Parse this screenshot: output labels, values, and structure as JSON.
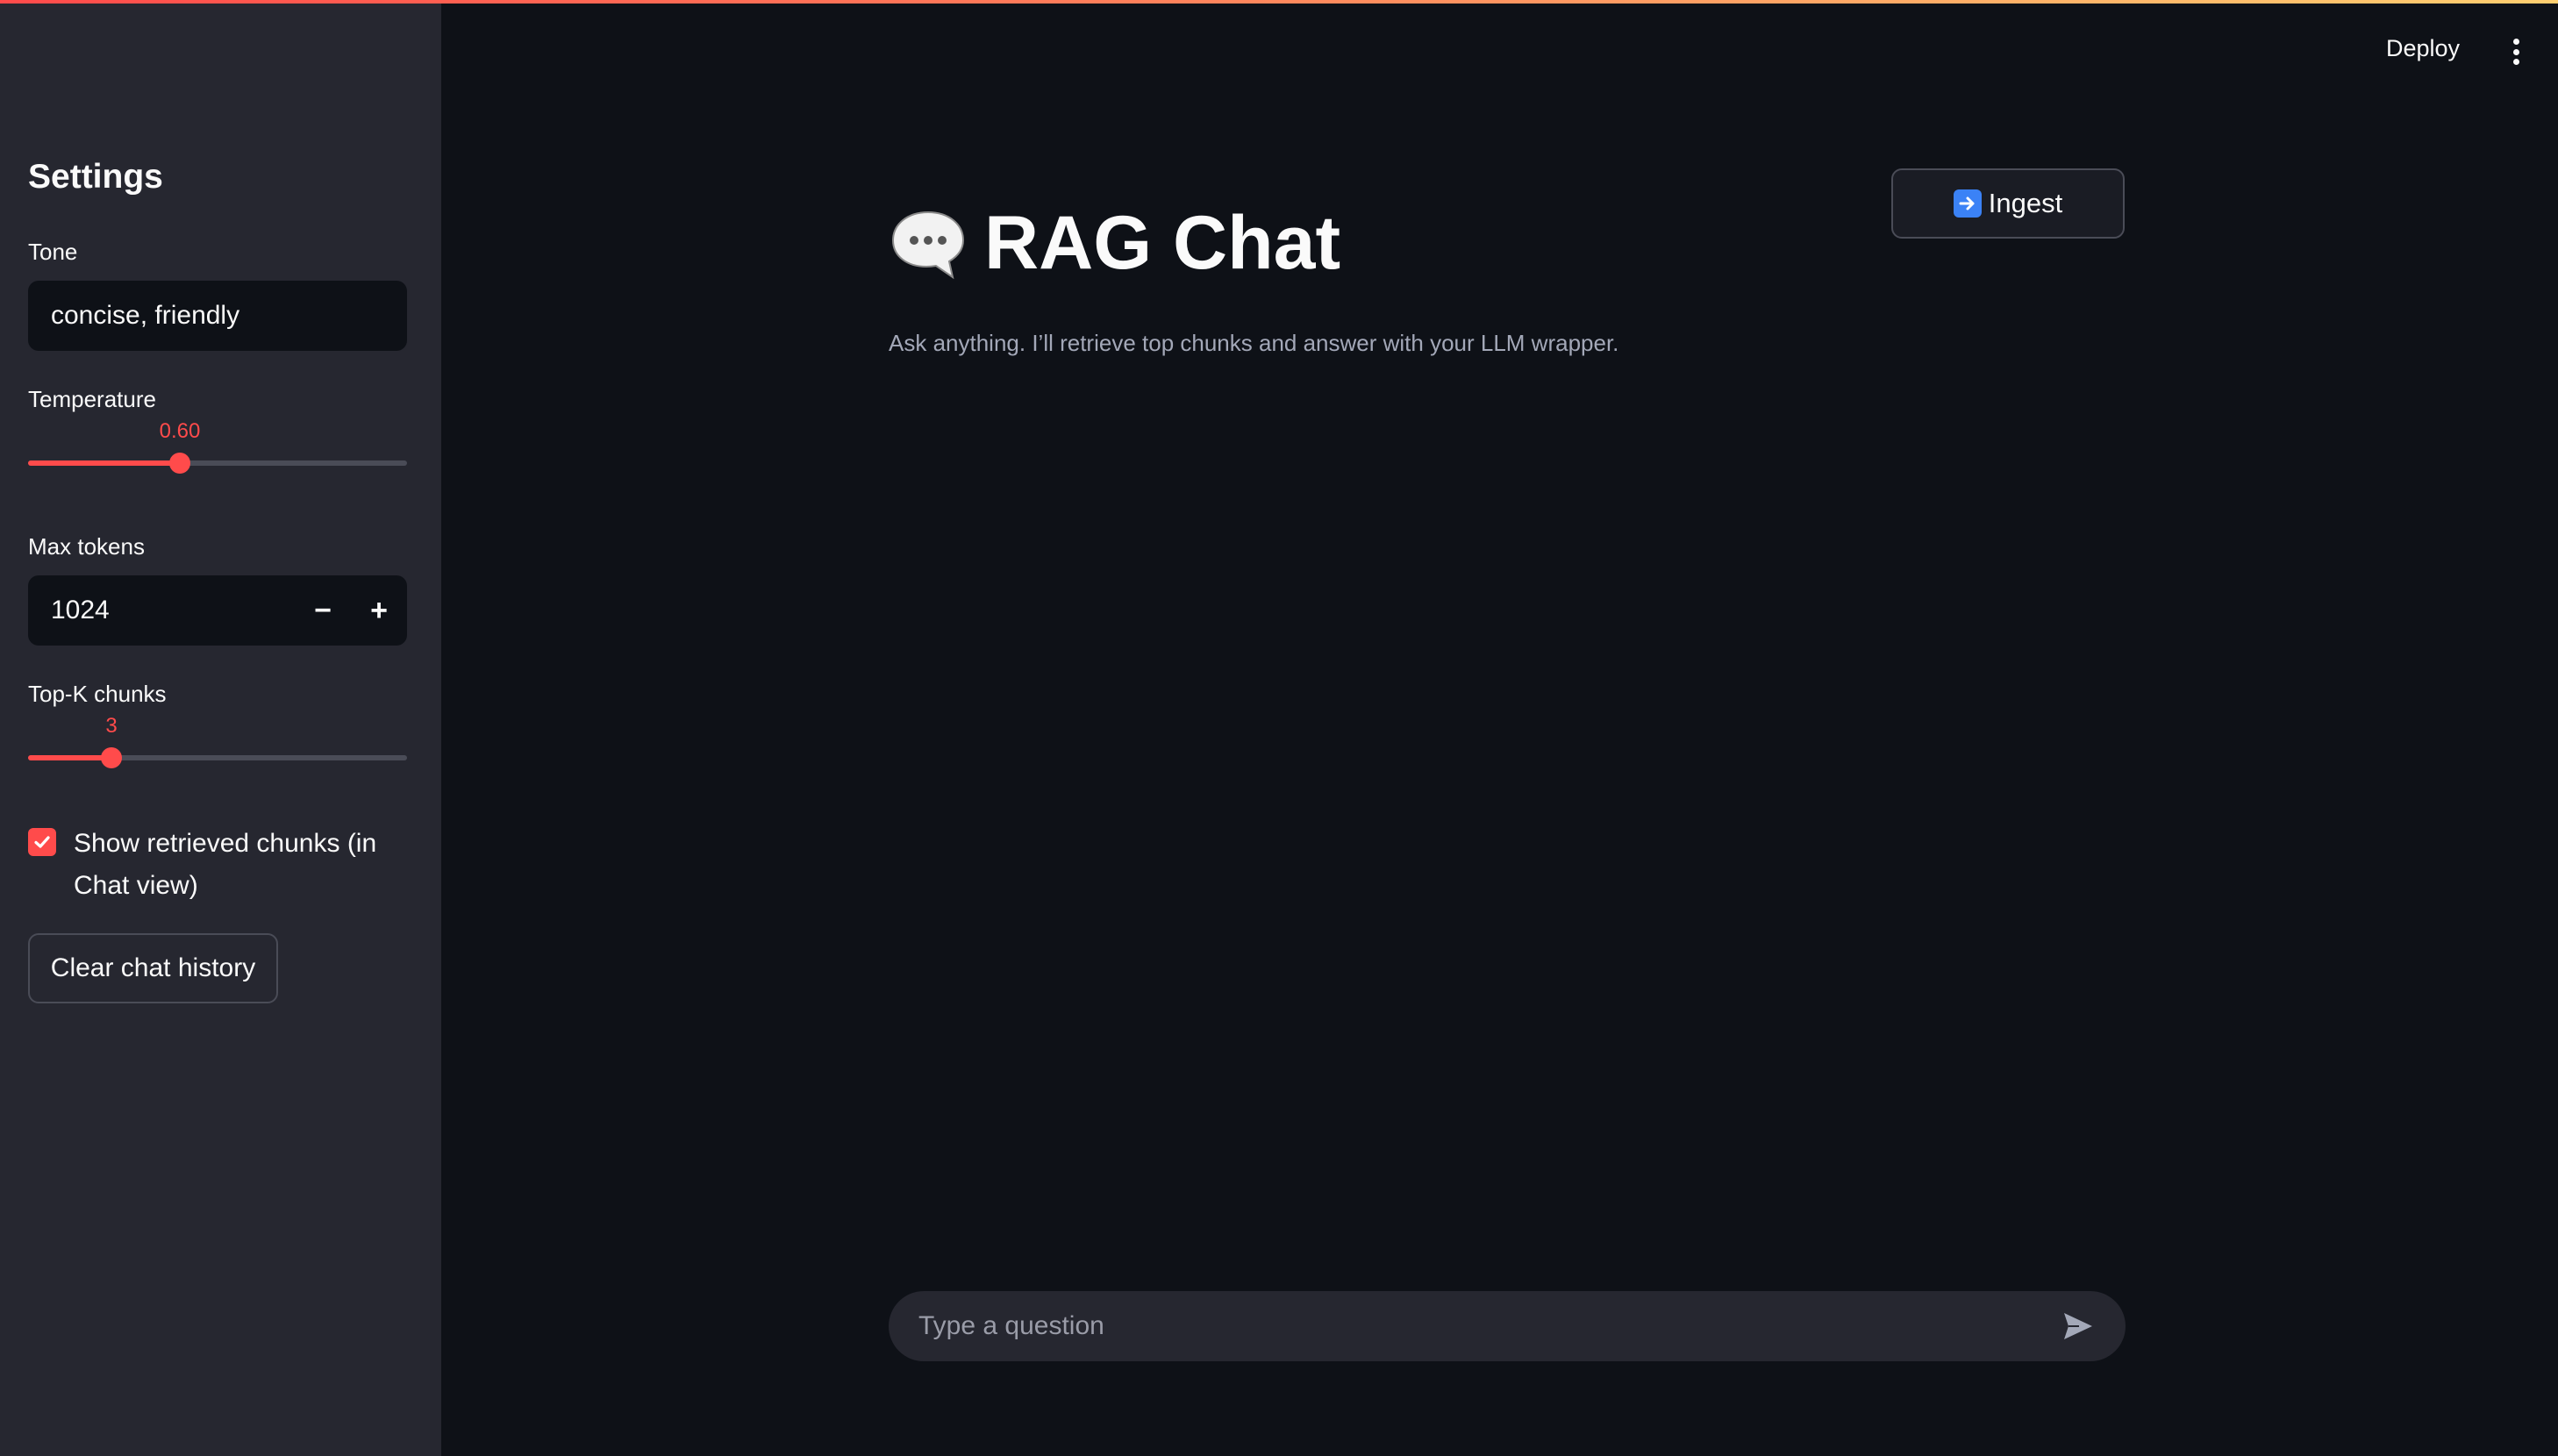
{
  "header": {
    "deploy_label": "Deploy",
    "menu_icon": "kebab-menu-icon"
  },
  "sidebar": {
    "title": "Settings",
    "tone": {
      "label": "Tone",
      "value": "concise, friendly"
    },
    "temperature": {
      "label": "Temperature",
      "value": "0.60",
      "fraction": 0.4
    },
    "max_tokens": {
      "label": "Max tokens",
      "value": "1024",
      "minus": "−",
      "plus": "+"
    },
    "top_k": {
      "label": "Top-K chunks",
      "value": "3",
      "fraction": 0.22
    },
    "show_chunks": {
      "label": "Show retrieved chunks (in Chat view)",
      "checked": true
    },
    "clear_label": "Clear chat history"
  },
  "main": {
    "ingest_label": "Ingest",
    "title": "RAG Chat",
    "subtitle": "Ask anything. I’ll retrieve top chunks and answer with your LLM wrapper.",
    "chat_placeholder": "Type a question"
  },
  "colors": {
    "accent": "#ff4b4b",
    "background": "#0e1117",
    "sidebar": "#262730"
  }
}
